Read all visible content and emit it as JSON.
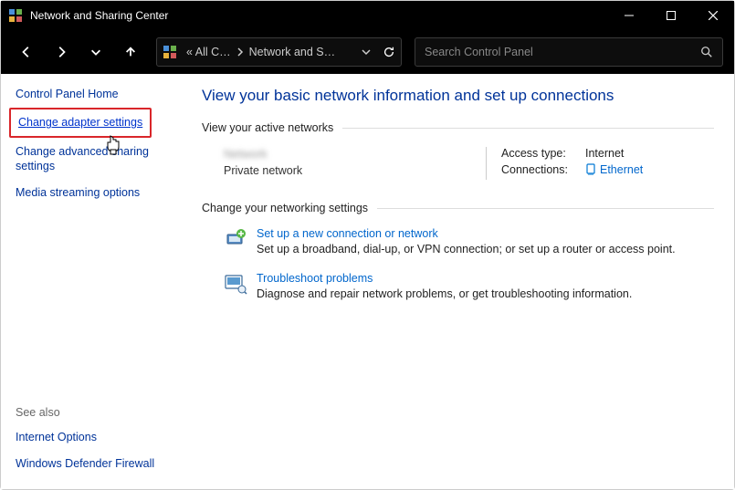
{
  "window": {
    "title": "Network and Sharing Center"
  },
  "address": {
    "seg1": "«  All C…",
    "seg2": "Network and S…"
  },
  "search": {
    "placeholder": "Search Control Panel"
  },
  "sidebar": {
    "home": "Control Panel Home",
    "adapter": "Change adapter settings",
    "advanced": "Change advanced sharing settings",
    "media": "Media streaming options",
    "see_also": "See also",
    "internet_options": "Internet Options",
    "firewall": "Windows Defender Firewall"
  },
  "main": {
    "heading": "View your basic network information and set up connections",
    "active_header": "View your active networks",
    "net_name": "Network",
    "net_type": "Private network",
    "access_type_label": "Access type:",
    "access_type_value": "Internet",
    "connections_label": "Connections:",
    "connections_value": "Ethernet",
    "change_header": "Change your networking settings",
    "setup_title": "Set up a new connection or network",
    "setup_desc": "Set up a broadband, dial-up, or VPN connection; or set up a router or access point.",
    "troubleshoot_title": "Troubleshoot problems",
    "troubleshoot_desc": "Diagnose and repair network problems, or get troubleshooting information."
  }
}
